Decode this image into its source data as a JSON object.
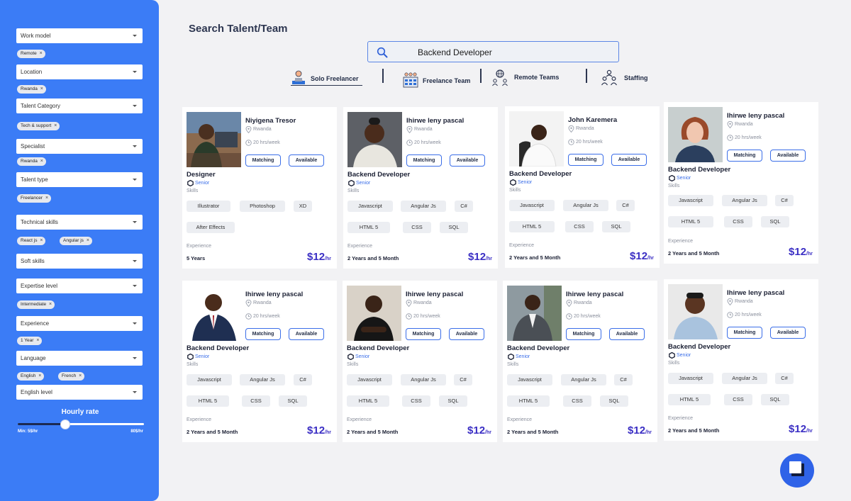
{
  "sidebar": {
    "filters": {
      "work_model": "Work model",
      "location": "Location",
      "talent_category": "Talent Category",
      "specialist": "Specialist",
      "talent_type": "Talent type",
      "technical_skills": "Technical skills",
      "soft_skills": "Soft skills",
      "expertise_level": "Expertise level",
      "experience": "Experience",
      "language": "Language",
      "english_level": "English level"
    },
    "chips": {
      "work_model": [
        "Remote"
      ],
      "location": [
        "Rwanda"
      ],
      "talent_category": [
        "Tech & support"
      ],
      "specialist": [
        "Rwanda"
      ],
      "talent_type": [
        "Freelancer"
      ],
      "technical_skills": [
        "React js",
        "Angular js"
      ],
      "expertise_level": [
        "Intermediate"
      ],
      "experience": [
        "1 Year"
      ],
      "language": [
        "English",
        "French"
      ]
    },
    "chip_remove": "×",
    "hourly_rate": {
      "title": "Hourly rate",
      "min_label": "Min:  5$/hr",
      "max_label": "80$/hr",
      "value_fraction": 0.37
    }
  },
  "header": {
    "title": "Search Talent/Team",
    "search_value": "Backend Developer",
    "tabs": [
      {
        "label": "Solo Freelancer",
        "icon": "solo-freelancer-icon",
        "active": true
      },
      {
        "label": "Freelance Team",
        "icon": "freelance-team-icon",
        "active": false
      },
      {
        "label": "Remote Teams",
        "icon": "remote-teams-icon",
        "active": false
      },
      {
        "label": "Staffing",
        "icon": "staffing-icon",
        "active": false
      }
    ]
  },
  "card_common": {
    "matching_label": "Matching",
    "available_label": "Available",
    "skills_label": "Skills",
    "experience_label": "Experience",
    "price_unit": "/hr"
  },
  "cards": [
    {
      "name": "Niyigena Tresor",
      "location": "Rwanda",
      "hours": "20 hrs/week",
      "role": "Designer",
      "level": "Senior",
      "skills": [
        "Illustrator",
        "Photoshop",
        "XD",
        "After Effects"
      ],
      "experience": "5 Years",
      "price": "$12"
    },
    {
      "name": "Ihirwe leny pascal",
      "location": "Rwanda",
      "hours": "20 hrs/week",
      "role": "Backend Developer",
      "level": "Senior",
      "skills": [
        "Javascript",
        "Angular Js",
        "C#",
        "HTML 5",
        "CSS",
        "SQL"
      ],
      "experience": "2 Years and 5 Month",
      "price": "$12"
    },
    {
      "name": "John Karemera",
      "location": "Rwanda",
      "hours": "20 hrs/week",
      "role": "Backend Developer",
      "level": "Senior",
      "skills": [
        "Javascript",
        "Angular Js",
        "C#",
        "HTML 5",
        "CSS",
        "SQL"
      ],
      "experience": "2 Years and 5 Month",
      "price": "$12"
    },
    {
      "name": "Ihirwe leny pascal",
      "location": "Rwanda",
      "hours": "20 hrs/week",
      "role": "Backend Developer",
      "level": "Senior",
      "skills": [
        "Javascript",
        "Angular Js",
        "C#",
        "HTML 5",
        "CSS",
        "SQL"
      ],
      "experience": "2 Years and 5 Month",
      "price": "$12"
    },
    {
      "name": "Ihirwe leny pascal",
      "location": "Rwanda",
      "hours": "20 hrs/week",
      "role": "Backend Developer",
      "level": "Senior",
      "skills": [
        "Javascript",
        "Angular Js",
        "C#",
        "HTML 5",
        "CSS",
        "SQL"
      ],
      "experience": "2 Years and 5 Month",
      "price": "$12"
    },
    {
      "name": "Ihirwe leny pascal",
      "location": "Rwanda",
      "hours": "20 hrs/week",
      "role": "Backend Developer",
      "level": "Senior",
      "skills": [
        "Javascript",
        "Angular Js",
        "C#",
        "HTML 5",
        "CSS",
        "SQL"
      ],
      "experience": "2 Years and 5 Month",
      "price": "$12"
    },
    {
      "name": "Ihirwe leny pascal",
      "location": "Rwanda",
      "hours": "20 hrs/week",
      "role": "Backend Developer",
      "level": "Senior",
      "skills": [
        "Javascript",
        "Angular Js",
        "C#",
        "HTML 5",
        "CSS",
        "SQL"
      ],
      "experience": "2 Years and 5 Month",
      "price": "$12"
    },
    {
      "name": "Ihirwe leny pascal",
      "location": "Rwanda",
      "hours": "20 hrs/week",
      "role": "Backend Developer",
      "level": "Senior",
      "skills": [
        "Javascript",
        "Angular Js",
        "C#",
        "HTML 5",
        "CSS",
        "SQL"
      ],
      "experience": "2 Years and 5 Month",
      "price": "$12"
    }
  ],
  "colors": {
    "sidebar": "#3b7cf6",
    "accent": "#3b6ee8",
    "price": "#3b2fc4",
    "fab": "#2f63e8"
  }
}
